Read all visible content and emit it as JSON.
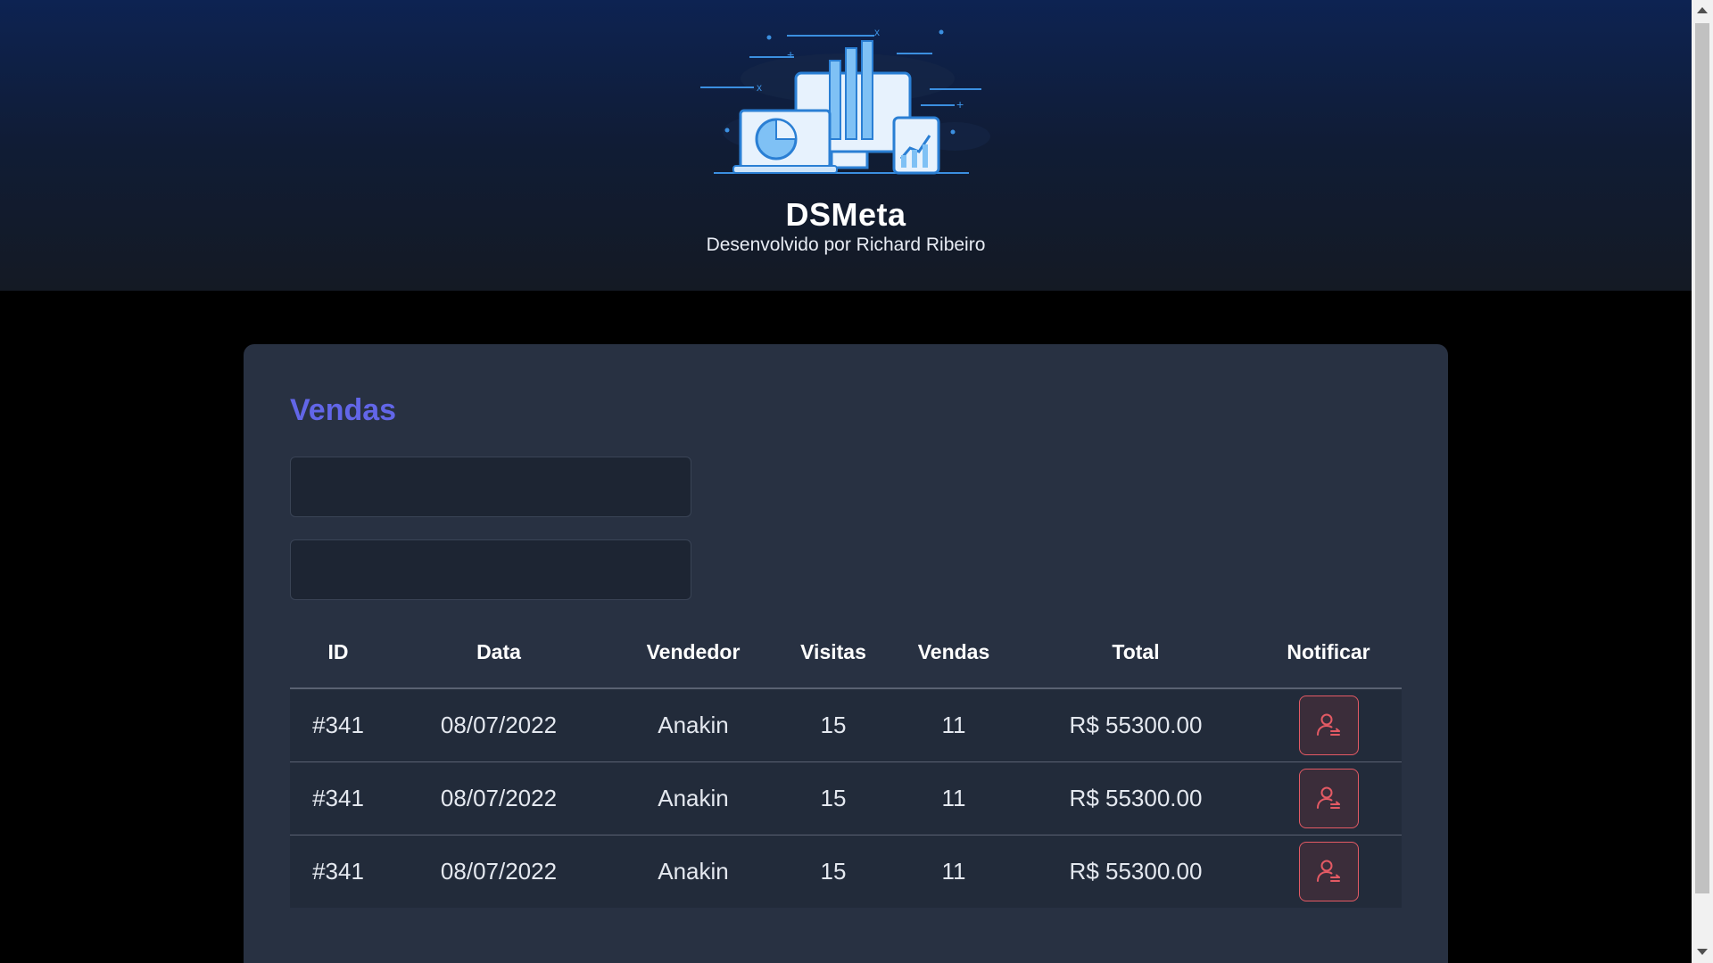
{
  "header": {
    "title": "DSMeta",
    "subtitle": "Desenvolvido por Richard Ribeiro",
    "logo_icon": "dashboard-devices-illustration"
  },
  "sales": {
    "title": "Vendas",
    "min_date": {
      "value": "",
      "placeholder": ""
    },
    "max_date": {
      "value": "",
      "placeholder": ""
    },
    "columns": [
      "ID",
      "Data",
      "Vendedor",
      "Visitas",
      "Vendas",
      "Total",
      "Notificar"
    ],
    "rows": [
      {
        "id": "#341",
        "date": "08/07/2022",
        "seller": "Anakin",
        "visits": "15",
        "deals": "11",
        "total": "R$ 55300.00"
      },
      {
        "id": "#341",
        "date": "08/07/2022",
        "seller": "Anakin",
        "visits": "15",
        "deals": "11",
        "total": "R$ 55300.00"
      },
      {
        "id": "#341",
        "date": "08/07/2022",
        "seller": "Anakin",
        "visits": "15",
        "deals": "11",
        "total": "R$ 55300.00"
      }
    ],
    "notify_icon": "user-notify-icon"
  },
  "colors": {
    "header_top": "#0d2352",
    "card_bg": "#283142",
    "accent_title": "#6266e8",
    "notify_red": "#e45a64"
  }
}
